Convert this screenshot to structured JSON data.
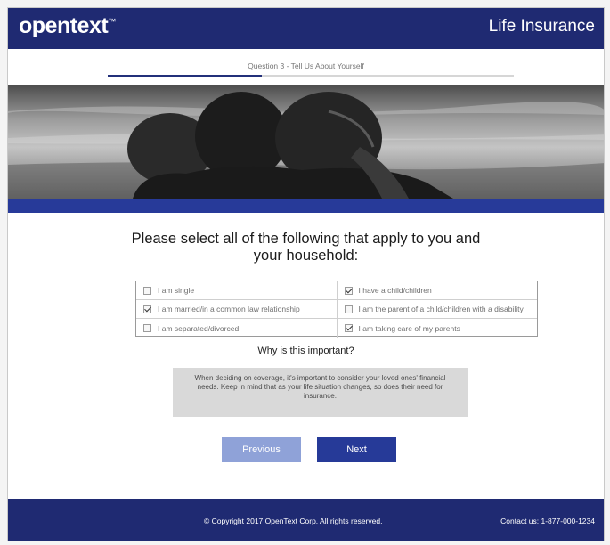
{
  "header": {
    "logo_text": "opentext",
    "logo_mark": "™",
    "app_title": "Life Insurance"
  },
  "progress": {
    "step_label": "Question 3 - Tell Us About Yourself",
    "fraction_complete": 0.38
  },
  "question": {
    "line1": "Please select all of the following that apply to you and",
    "line2": "your household:"
  },
  "options": [
    {
      "label": "I am single",
      "checked": false
    },
    {
      "label": "I have a child/children",
      "checked": true
    },
    {
      "label": "I am married/in a common law relationship",
      "checked": true
    },
    {
      "label": "I am the parent of a child/children with a disability",
      "checked": false
    },
    {
      "label": "I am separated/divorced",
      "checked": false
    },
    {
      "label": "I am taking care of my parents",
      "checked": true
    }
  ],
  "why": {
    "title": "Why is this important?",
    "body": "When deciding on coverage, it's important to consider your loved ones' financial needs. Keep in mind that as your life situation changes, so does their need for insurance."
  },
  "buttons": {
    "previous": "Previous",
    "next": "Next"
  },
  "footer": {
    "copyright": "© Copyright 2017 OpenText Corp. All rights reserved.",
    "contact": "Contact us: 1-877-000-1234"
  },
  "colors": {
    "header_bg": "#1f2a72",
    "accent": "#263a98",
    "previous_button": "#8fa2d8"
  }
}
